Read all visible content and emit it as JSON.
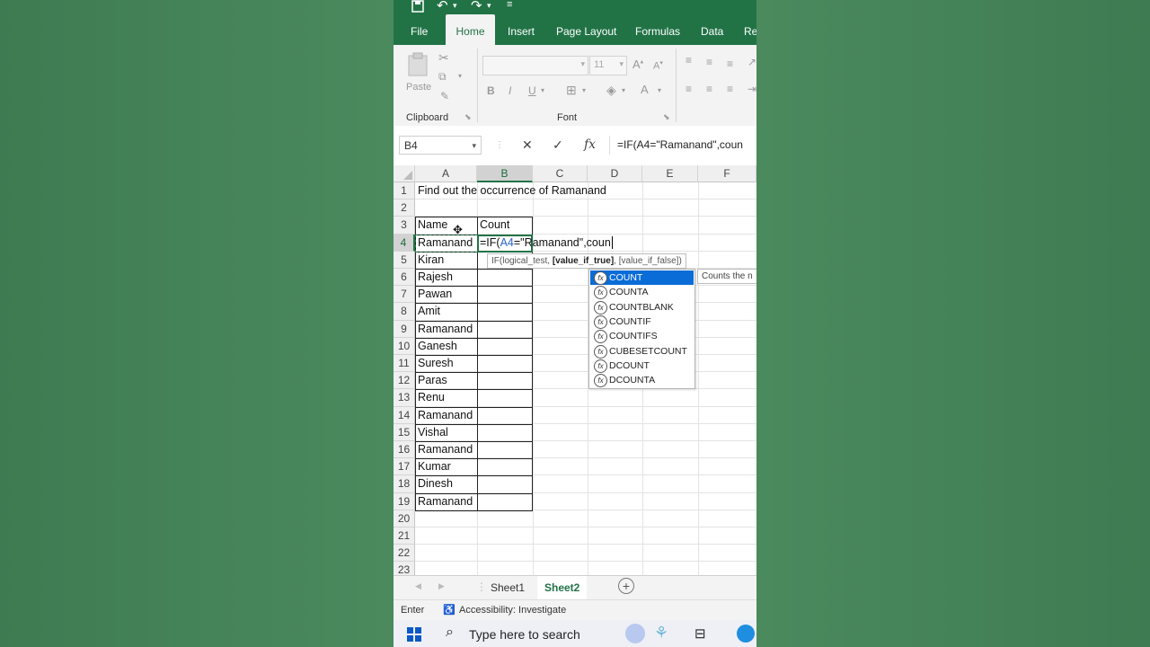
{
  "qat": {
    "save_icon": "save-icon",
    "undo_icon": "undo-icon",
    "redo_icon": "redo-icon"
  },
  "tabs": [
    "File",
    "Home",
    "Insert",
    "Page Layout",
    "Formulas",
    "Data",
    "Re"
  ],
  "ribbon": {
    "clipboard_label": "Clipboard",
    "paste_label": "Paste",
    "font_label": "Font",
    "font_size": "11"
  },
  "formula_bar": {
    "name_box": "B4",
    "cancel": "✕",
    "enter": "✓",
    "fx": "fx",
    "formula": "=IF(A4=\"Ramanand\",coun"
  },
  "columns": [
    "A",
    "B",
    "C",
    "D",
    "E",
    "F"
  ],
  "rows": [
    "1",
    "2",
    "3",
    "4",
    "5",
    "6",
    "7",
    "8",
    "9",
    "10",
    "11",
    "12",
    "13",
    "14",
    "15",
    "16",
    "17",
    "18",
    "19",
    "20",
    "21",
    "22",
    "23"
  ],
  "cells": {
    "a1": "Find out the occurrence of Ramanand",
    "a3": "Name",
    "b3": "Count",
    "b4_prefix": "=IF(",
    "b4_ref": "A4",
    "b4_suffix": "=\"Ramanand\",coun",
    "names": [
      "Ramanand",
      "Kiran",
      "Rajesh",
      "Pawan",
      "Amit",
      "Ramanand",
      "Ganesh",
      "Suresh",
      "Paras",
      "Renu",
      "Ramanand",
      "Vishal",
      "Ramanand",
      "Kumar",
      "Dinesh",
      "Ramanand"
    ]
  },
  "tooltip": {
    "fn": "IF(logical_test, ",
    "arg": "[value_if_true]",
    ", ": ", ",
    "rest": "[value_if_false])"
  },
  "autocomplete": [
    "COUNT",
    "COUNTA",
    "COUNTBLANK",
    "COUNTIF",
    "COUNTIFS",
    "CUBESETCOUNT",
    "DCOUNT",
    "DCOUNTA"
  ],
  "autocomplete_desc": "Counts the n",
  "sheets": [
    "Sheet1",
    "Sheet2"
  ],
  "status": {
    "mode": "Enter",
    "accessibility": "Accessibility: Investigate"
  },
  "taskbar": {
    "search_placeholder": "Type here to search"
  }
}
